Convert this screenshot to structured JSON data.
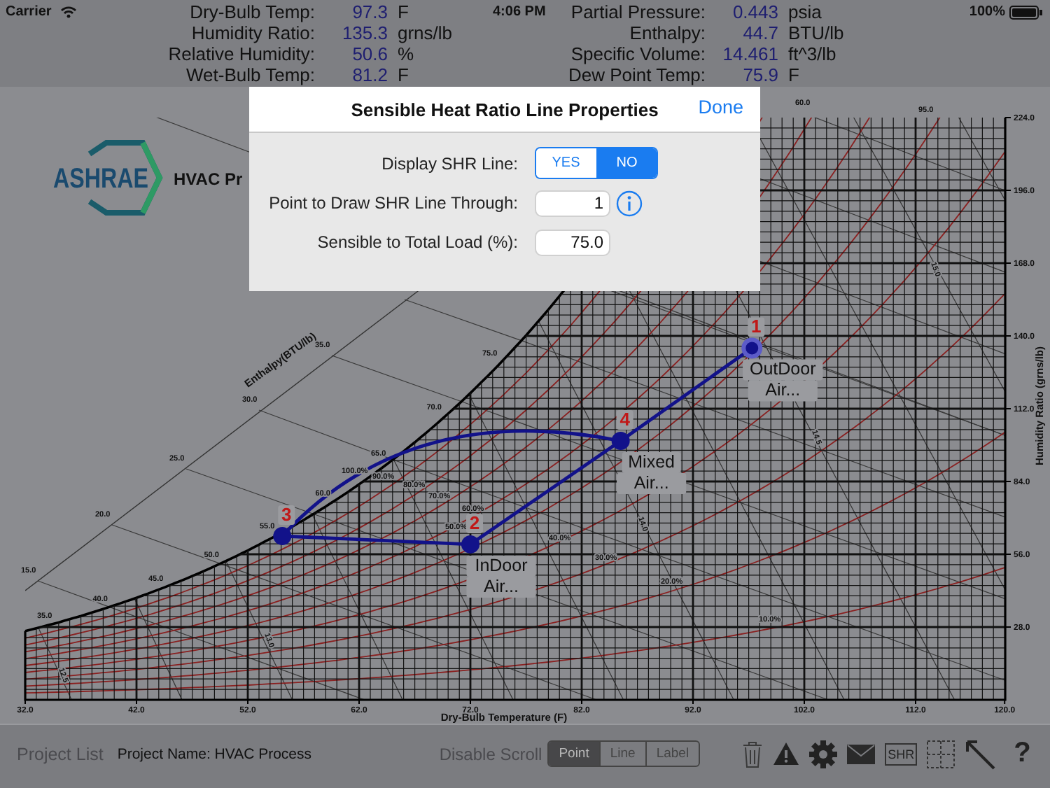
{
  "status_bar": {
    "carrier": "Carrier",
    "time": "4:06 PM",
    "battery": "100%"
  },
  "readouts_left": [
    {
      "label": "Dry-Bulb Temp:",
      "value": "97.3",
      "unit": "F"
    },
    {
      "label": "Humidity Ratio:",
      "value": "135.3",
      "unit": "grns/lb"
    },
    {
      "label": "Relative Humidity:",
      "value": "50.6",
      "unit": "%"
    },
    {
      "label": "Wet-Bulb Temp:",
      "value": "81.2",
      "unit": "F"
    }
  ],
  "readouts_right": [
    {
      "label": "Partial Pressure:",
      "value": "0.443",
      "unit": "psia"
    },
    {
      "label": "Enthalpy:",
      "value": "44.7",
      "unit": "BTU/lb"
    },
    {
      "label": "Specific Volume:",
      "value": "14.461",
      "unit": "ft^3/lb"
    },
    {
      "label": "Dew Point Temp:",
      "value": "75.9",
      "unit": "F"
    }
  ],
  "logo": {
    "text": "ASHRAE"
  },
  "chart_title": "HVAC Pr",
  "chart": {
    "chart_data": {
      "type": "scatter",
      "xlabel": "Dry-Bulb Temperature (F)",
      "ylabel": "Humidity Ratio (grns/lb)",
      "x": [
        97.3,
        72.0,
        55.1,
        85.5
      ],
      "series": [
        {
          "color": "#12128a",
          "values": [
            135.3,
            59.8,
            63.0,
            99.6
          ]
        }
      ],
      "xlim": [
        32,
        120
      ],
      "ylim": [
        0,
        224
      ],
      "grid": true,
      "xticks": [
        {
          "value": 32,
          "label": "32.0"
        },
        {
          "value": 42,
          "label": "42.0"
        },
        {
          "value": 52,
          "label": "52.0"
        },
        {
          "value": 62,
          "label": "62.0"
        },
        {
          "value": 72,
          "label": "72.0"
        },
        {
          "value": 82,
          "label": "82.0"
        },
        {
          "value": 92,
          "label": "92.0"
        },
        {
          "value": 102,
          "label": "102.0"
        },
        {
          "value": 112,
          "label": "112.0"
        },
        {
          "value": 120,
          "label": "120.0"
        }
      ],
      "yticks": [
        {
          "value": 28,
          "label": "28.0"
        },
        {
          "value": 56,
          "label": "56.0"
        },
        {
          "value": 84,
          "label": "84.0"
        },
        {
          "value": 112,
          "label": "112.0"
        },
        {
          "value": 140,
          "label": "140.0"
        },
        {
          "value": 168,
          "label": "168.0"
        },
        {
          "value": 196,
          "label": "196.0"
        },
        {
          "value": 224,
          "label": "224.0"
        }
      ]
    },
    "points": [
      {
        "number": "1",
        "label_lines": [
          "OutDoor",
          "Air..."
        ],
        "selected": true
      },
      {
        "number": "2",
        "label_lines": [
          "InDoor",
          "Air..."
        ],
        "selected": false
      },
      {
        "number": "3",
        "selected": false
      },
      {
        "number": "4",
        "label_lines": [
          "Mixed",
          "Air..."
        ],
        "selected": false
      }
    ],
    "enthalpy_title": "Enthalpy(BTU/lb)",
    "enthalpy_labels": [
      "15.0",
      "20.0",
      "25.0",
      "30.0",
      "35.0"
    ],
    "saturation_labels": [
      "35.0",
      "40.0",
      "45.0",
      "50.0",
      "55.0",
      "60.0",
      "65.0",
      "70.0",
      "75.0"
    ],
    "top_labels": [
      "60.0",
      "95.0"
    ],
    "rh_labels": [
      "100.0%",
      "90.0%",
      "80.0%",
      "70.0%",
      "60.0%",
      "50.0%",
      "40.0%",
      "30.0%",
      "20.0%",
      "10.0%"
    ],
    "volume_labels": [
      "12.5",
      "13.0",
      "14.0",
      "14.5",
      "15.0"
    ]
  },
  "dialog": {
    "title": "Sensible Heat Ratio Line Properties",
    "done": "Done",
    "display_label": "Display SHR Line:",
    "display_options": [
      {
        "label": "YES",
        "selected": false
      },
      {
        "label": "NO",
        "selected": true
      }
    ],
    "point_label": "Point to Draw SHR Line Through:",
    "point_value": "1",
    "load_label": "Sensible to Total Load (%):",
    "load_value": "75.0"
  },
  "toolbar": {
    "project_list": "Project List",
    "project_name": "Project Name: HVAC Process",
    "disable_scroll": "Disable Scroll",
    "modes": [
      {
        "label": "Point",
        "selected": true
      },
      {
        "label": "Line",
        "selected": false
      },
      {
        "label": "Label",
        "selected": false
      }
    ],
    "shr": "SHR",
    "help": "?"
  }
}
